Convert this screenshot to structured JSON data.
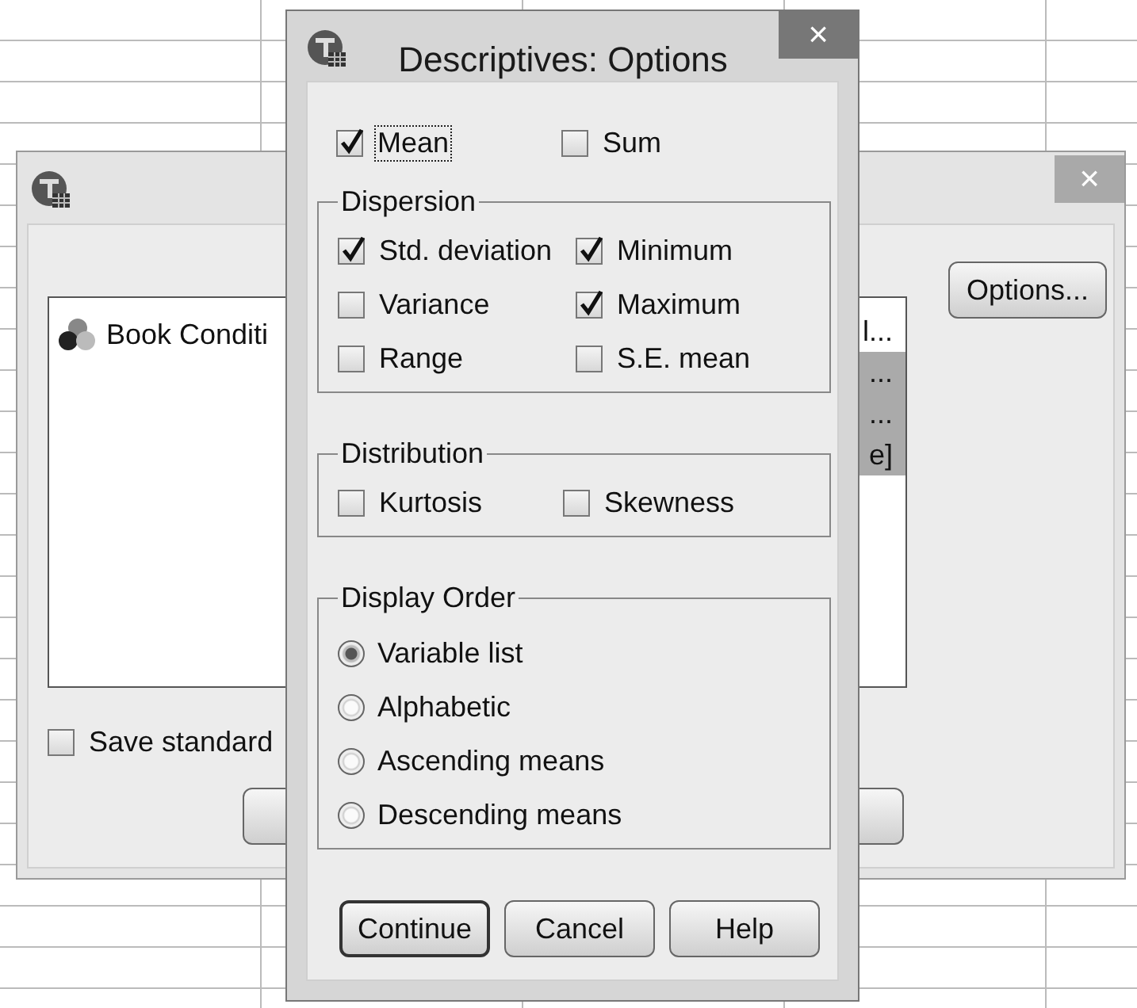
{
  "background_dialog": {
    "close": "×",
    "variable_list": [
      {
        "label": "Book Conditi"
      }
    ],
    "selected_list": [
      {
        "label": "l...",
        "selected": false
      },
      {
        "label": "...",
        "selected": true
      },
      {
        "label": "...",
        "selected": true
      },
      {
        "label": "e]",
        "selected": true
      }
    ],
    "options_button": "Options...",
    "save_checkbox": {
      "label": "Save standard",
      "checked": false
    }
  },
  "options_dialog": {
    "title": "Descriptives: Options",
    "close": "×",
    "top_checks": [
      {
        "label": "Mean",
        "checked": true,
        "focused": true
      },
      {
        "label": "Sum",
        "checked": false,
        "focused": false
      }
    ],
    "dispersion": {
      "legend": "Dispersion",
      "items": [
        {
          "label": "Std. deviation",
          "checked": true
        },
        {
          "label": "Minimum",
          "checked": true
        },
        {
          "label": "Variance",
          "checked": false
        },
        {
          "label": "Maximum",
          "checked": true
        },
        {
          "label": "Range",
          "checked": false
        },
        {
          "label": "S.E. mean",
          "checked": false
        }
      ]
    },
    "distribution": {
      "legend": "Distribution",
      "items": [
        {
          "label": "Kurtosis",
          "checked": false
        },
        {
          "label": "Skewness",
          "checked": false
        }
      ]
    },
    "display_order": {
      "legend": "Display Order",
      "options": [
        {
          "label": "Variable list",
          "selected": true
        },
        {
          "label": "Alphabetic",
          "selected": false
        },
        {
          "label": "Ascending means",
          "selected": false
        },
        {
          "label": "Descending means",
          "selected": false
        }
      ]
    },
    "buttons": [
      {
        "label": "Continue",
        "default": true
      },
      {
        "label": "Cancel",
        "default": false
      },
      {
        "label": "Help",
        "default": false
      }
    ]
  }
}
